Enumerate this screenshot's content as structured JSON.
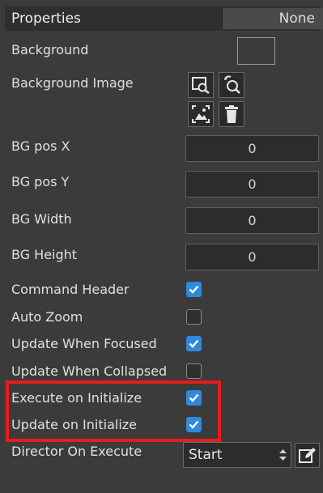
{
  "header": {
    "title": "Properties",
    "mode_button": "None"
  },
  "properties": {
    "background": "Background",
    "background_image": "Background Image",
    "bg_pos_x": {
      "label": "BG pos X",
      "value": "0"
    },
    "bg_pos_y": {
      "label": "BG pos Y",
      "value": "0"
    },
    "bg_width": {
      "label": "BG Width",
      "value": "0"
    },
    "bg_height": {
      "label": "BG Height",
      "value": "0"
    },
    "command_header": {
      "label": "Command Header",
      "checked": true
    },
    "auto_zoom": {
      "label": "Auto Zoom",
      "checked": false
    },
    "update_when_focused": {
      "label": "Update When Focused",
      "checked": true
    },
    "update_when_collapsed": {
      "label": "Update When Collapsed",
      "checked": false
    },
    "execute_on_initialize": {
      "label": "Execute on Initialize",
      "checked": true
    },
    "update_on_initialize": {
      "label": "Update on Initialize",
      "checked": true
    },
    "director_on_execute": {
      "label": "Director On Execute",
      "value": "Start"
    }
  },
  "icons": {
    "image_buttons": [
      "browse-image-icon",
      "search-image-icon",
      "preview-image-icon",
      "trash-icon"
    ],
    "select_arrows": "up-down-arrows-icon",
    "edit": "edit-icon"
  },
  "colors": {
    "panel_bg": "#3b3b3b",
    "checkbox_on": "#2f8ad9",
    "highlight": "#e51d1d"
  }
}
